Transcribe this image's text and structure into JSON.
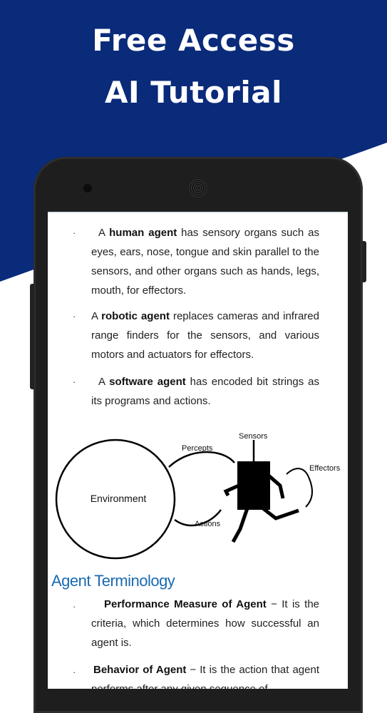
{
  "promo": {
    "title_line1": "Free Access",
    "title_line2": "AI Tutorial",
    "background_color": "#0a2a7a"
  },
  "content": {
    "items": [
      {
        "bullet": "·",
        "term": "human agent",
        "prefix": "A ",
        "text": " has sensory organs such as eyes, ears, nose, tongue and skin parallel to the sensors, and other organs such as hands, legs, mouth, for effectors."
      },
      {
        "bullet": "·",
        "term": "robotic agent",
        "prefix": "A ",
        "text": " replaces cameras and infrared range finders for the sensors, and various motors and actuators for effectors."
      },
      {
        "bullet": "·",
        "term": "software agent",
        "prefix": "A ",
        "text": " has encoded bit strings as its programs and actions."
      }
    ],
    "diagram": {
      "environment_label": "Environment",
      "percepts_label": "Percepts",
      "actions_label": "Actions",
      "sensors_label": "Sensors",
      "effectors_label": "Effectors"
    },
    "section_title": "Agent Terminology",
    "terminology": [
      {
        "bullet": "·",
        "term": "Performance Measure of Agent",
        "text": " − It is the criteria, which determines how successful an agent is."
      },
      {
        "bullet": "·",
        "term": "Behavior of Agent",
        "text": " − It is the action that agent performs after any given sequence of"
      }
    ],
    "section_title_color": "#1a6ab2"
  }
}
